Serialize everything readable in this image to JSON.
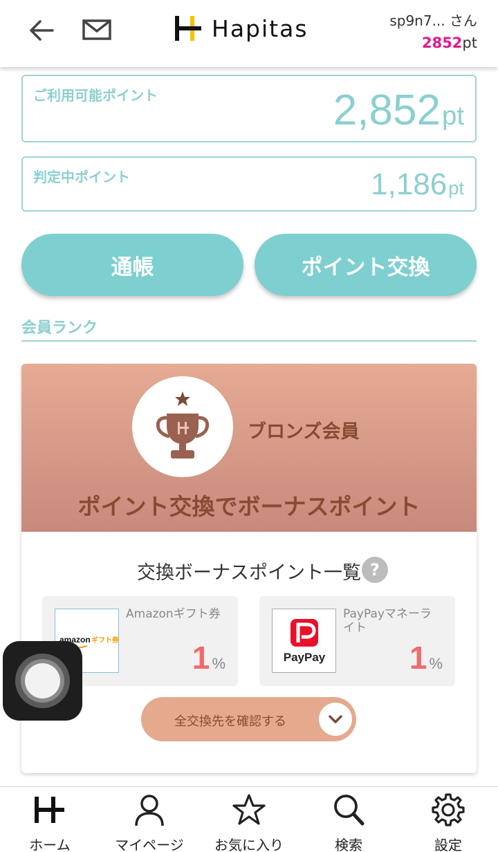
{
  "header": {
    "user_name": "sp9n7... さん",
    "points_value": "2852",
    "points_unit": "pt",
    "logo_text": "Hapitas"
  },
  "points": {
    "available_label": "ご利用可能ポイント",
    "available_value": "2,852",
    "pending_label": "判定中ポイント",
    "pending_value": "1,186",
    "unit": "pt"
  },
  "buttons": {
    "passbook": "通帳",
    "exchange": "ポイント交換"
  },
  "rank": {
    "section_title": "会員ランク",
    "rank_name": "ブロンズ会員",
    "bonus_title": "ポイント交換でボーナスポイント",
    "list_title": "交換ボーナスポイント一覧",
    "help": "?",
    "items": [
      {
        "name": "Amazonギフト券",
        "rate": "1",
        "unit": "%",
        "logo_main": "amazon",
        "logo_sub": "ギフト券"
      },
      {
        "name": "PayPayマネーライト",
        "rate": "1",
        "unit": "%",
        "logo_main": "PayPay"
      }
    ],
    "view_all": "全交換先を確認する"
  },
  "nav": {
    "items": [
      {
        "label": "ホーム",
        "icon": "hapitas-logo-icon"
      },
      {
        "label": "マイページ",
        "icon": "person-icon"
      },
      {
        "label": "お気に入り",
        "icon": "star-icon"
      },
      {
        "label": "検索",
        "icon": "search-icon"
      },
      {
        "label": "設定",
        "icon": "gear-icon"
      }
    ]
  },
  "colors": {
    "accent": "#7ecfcf",
    "points_highlight": "#e0198c",
    "bronze_text": "#8a4a32",
    "rate_red": "#f06c6c"
  }
}
